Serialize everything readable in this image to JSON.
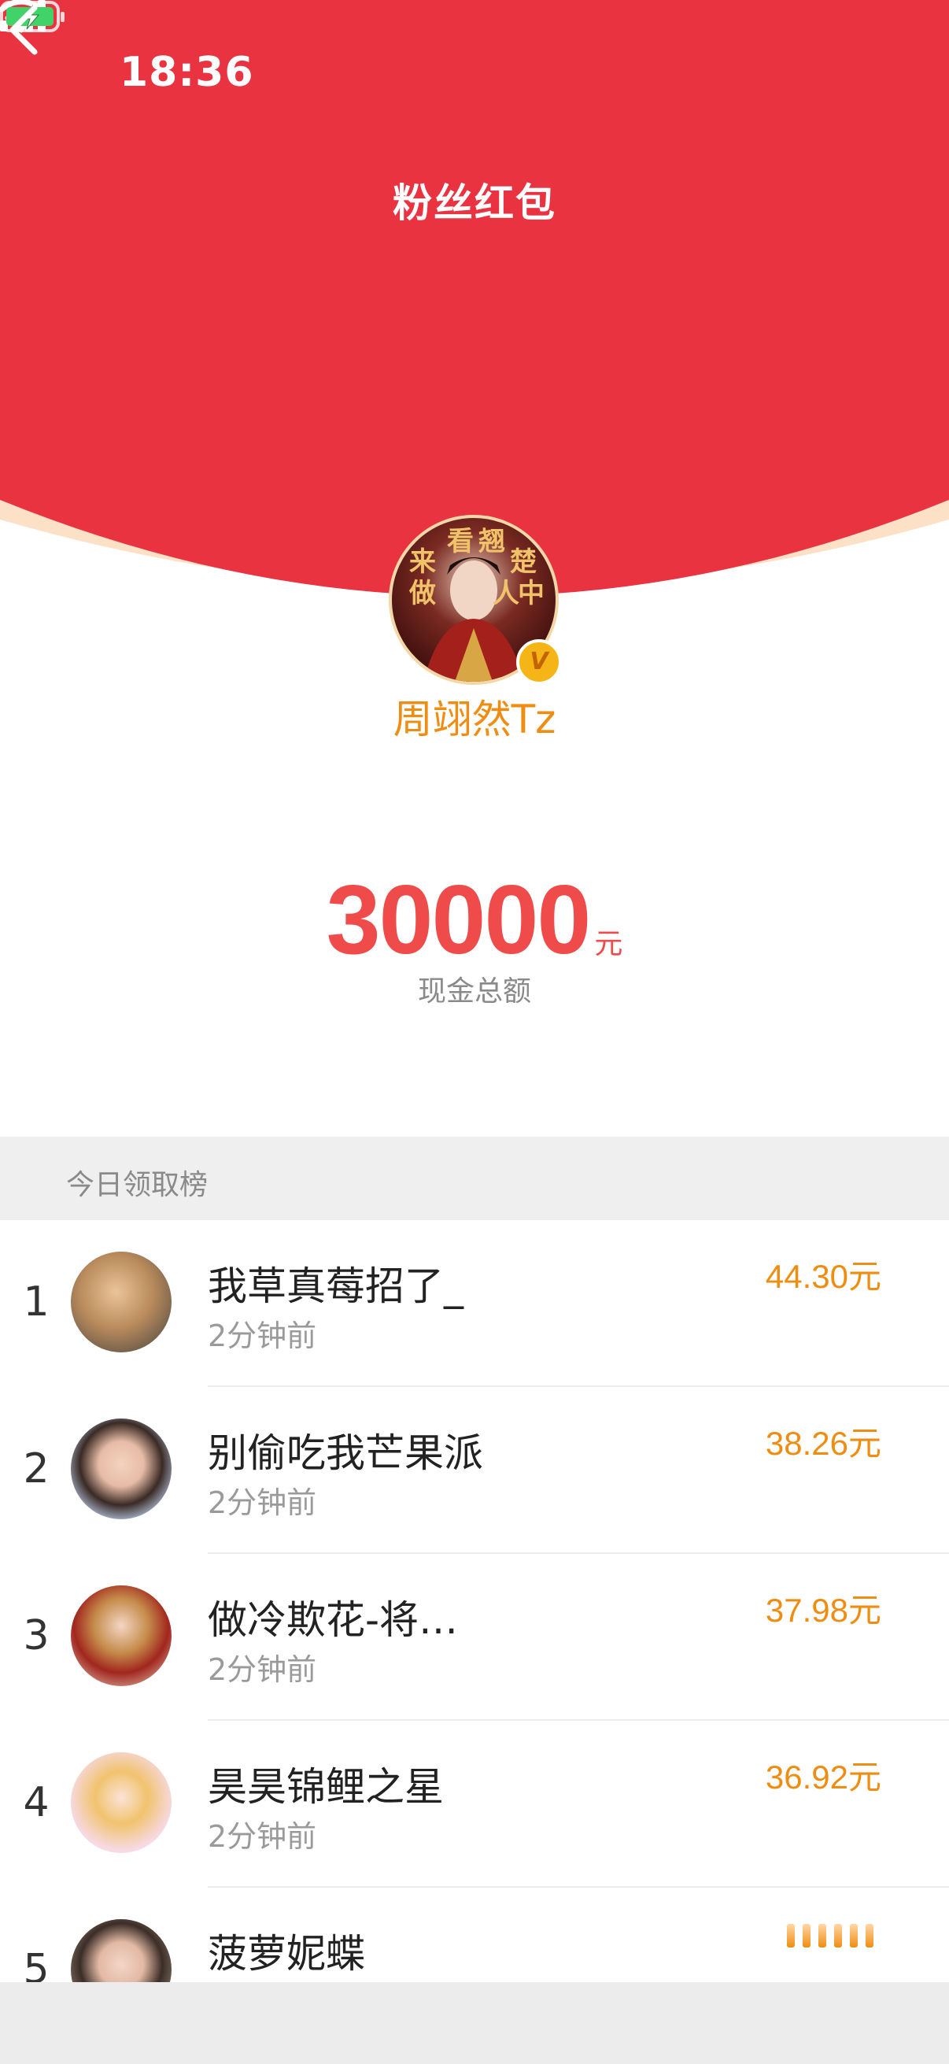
{
  "status_bar": {
    "time": "18:36"
  },
  "header": {
    "title": "粉丝红包",
    "colors": {
      "red": "#ea3340",
      "rim": "#fce1c6"
    }
  },
  "profile": {
    "username": "周翊然Tz",
    "avatar_text": [
      "看",
      "翘",
      "来",
      "楚",
      "做",
      "人",
      "中"
    ],
    "badge": "V"
  },
  "total": {
    "amount": "30000",
    "unit": "元",
    "label": "现金总额"
  },
  "ranking": {
    "title": "今日领取榜",
    "items": [
      {
        "rank": "1",
        "name": "我草真莓招了_",
        "time": "2分钟前",
        "amount": "44.30元"
      },
      {
        "rank": "2",
        "name": "别偷吃我芒果派",
        "time": "2分钟前",
        "amount": "38.26元"
      },
      {
        "rank": "3",
        "name": "做冷欺花-将…",
        "time": "2分钟前",
        "amount": "37.98元"
      },
      {
        "rank": "4",
        "name": "昊昊锦鲤之星",
        "time": "2分钟前",
        "amount": "36.92元"
      },
      {
        "rank": "5",
        "name": "菠萝妮蝶",
        "time": "",
        "amount": ""
      }
    ]
  }
}
